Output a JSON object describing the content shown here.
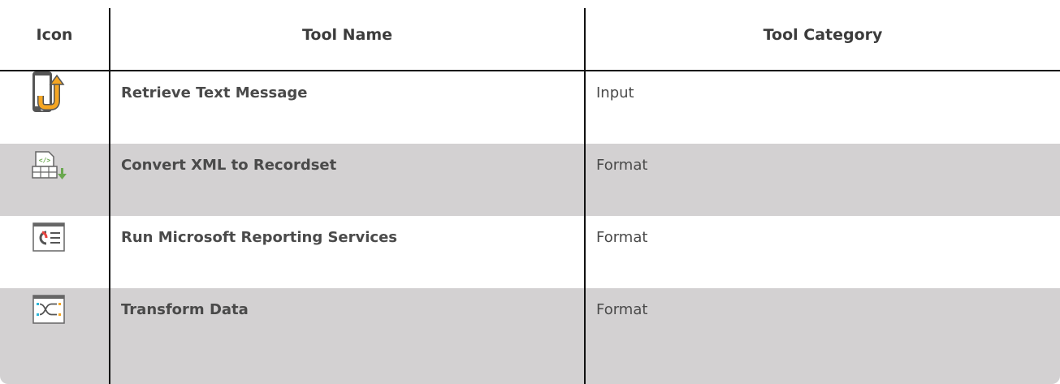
{
  "header": {
    "icon_col": "Icon",
    "name_col": "Tool Name",
    "category_col": "Tool Category"
  },
  "rows": [
    {
      "icon": "phone-retrieve-icon",
      "name": "Retrieve Text Message",
      "category": "Input",
      "shaded": false
    },
    {
      "icon": "xml-recordset-icon",
      "name": "Convert XML to Recordset",
      "category": "Format",
      "shaded": true
    },
    {
      "icon": "reporting-services-icon",
      "name": "Run Microsoft Reporting Services",
      "category": "Format",
      "shaded": false
    },
    {
      "icon": "transform-data-icon",
      "name": "Transform Data",
      "category": "Format",
      "shaded": true
    }
  ],
  "colors": {
    "shaded_row": "#d3d1d2",
    "text": "#4a4a4a",
    "accent_orange": "#f5a623",
    "accent_green": "#6aa84f",
    "accent_red": "#e8433f",
    "accent_blue": "#2bb5d9"
  }
}
